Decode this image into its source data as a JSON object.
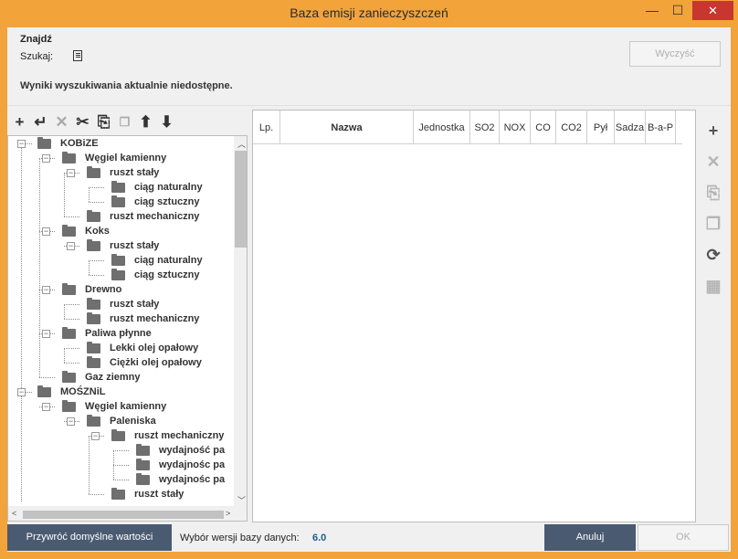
{
  "window": {
    "title": "Baza emisji zanieczyszczeń",
    "min_glyph": "—",
    "max_glyph": "☐",
    "close_glyph": "✕"
  },
  "search": {
    "section_title": "Znajdź",
    "label": "Szukaj:",
    "icon": "document-icon",
    "clear_button": "Wyczyść",
    "results_message": "Wyniki wyszukiwania aktualnie niedostępne."
  },
  "toolbar": {
    "icons": [
      {
        "name": "add-icon",
        "glyph": "+"
      },
      {
        "name": "insert-child-icon",
        "glyph": "↵"
      },
      {
        "name": "delete-icon",
        "glyph": "✕"
      },
      {
        "name": "cut-icon",
        "glyph": "✂"
      },
      {
        "name": "copy-icon",
        "glyph": "⎘"
      },
      {
        "name": "paste-icon",
        "glyph": "📋"
      },
      {
        "name": "save-up-icon",
        "glyph": "⬆"
      },
      {
        "name": "save-down-icon",
        "glyph": "⬇"
      }
    ]
  },
  "tree": {
    "nodes": [
      {
        "label": "KOBiZE",
        "level": 0
      },
      {
        "label": "Węgiel kamienny",
        "level": 1
      },
      {
        "label": "ruszt stały",
        "level": 2
      },
      {
        "label": "ciąg naturalny",
        "level": 3
      },
      {
        "label": "ciąg sztuczny",
        "level": 3
      },
      {
        "label": "ruszt mechaniczny",
        "level": 2
      },
      {
        "label": "Koks",
        "level": 1
      },
      {
        "label": "ruszt stały",
        "level": 2
      },
      {
        "label": "ciąg naturalny",
        "level": 3
      },
      {
        "label": "ciąg sztuczny",
        "level": 3
      },
      {
        "label": "Drewno",
        "level": 1
      },
      {
        "label": "ruszt stały",
        "level": 2
      },
      {
        "label": "ruszt mechaniczny",
        "level": 2
      },
      {
        "label": "Paliwa płynne",
        "level": 1
      },
      {
        "label": "Lekki olej opałowy",
        "level": 2
      },
      {
        "label": "Ciężki olej opałowy",
        "level": 2
      },
      {
        "label": "Gaz ziemny",
        "level": 1
      },
      {
        "label": "MOŚZNiL",
        "level": 0
      },
      {
        "label": "Węgiel kamienny",
        "level": 1
      },
      {
        "label": "Paleniska",
        "level": 2
      },
      {
        "label": "ruszt mechaniczny",
        "level": 3
      },
      {
        "label": "wydajność pa",
        "level": 4
      },
      {
        "label": "wydajnośc pa",
        "level": 4
      },
      {
        "label": "wydajnośc pa",
        "level": 4
      },
      {
        "label": "ruszt stały",
        "level": 3
      }
    ]
  },
  "grid": {
    "columns": [
      "Lp.",
      "Nazwa",
      "Jednostka",
      "SO2",
      "NOX",
      "CO",
      "CO2",
      "Pył",
      "Sadza",
      "B-a-P"
    ]
  },
  "right_toolbar": {
    "icons": [
      {
        "name": "add-icon",
        "glyph": "+",
        "enabled": true
      },
      {
        "name": "delete-icon",
        "glyph": "✕",
        "enabled": false
      },
      {
        "name": "copy-icon",
        "glyph": "⎘",
        "enabled": false
      },
      {
        "name": "paste-icon",
        "glyph": "❐",
        "enabled": false
      },
      {
        "name": "refresh-icon",
        "glyph": "⟳",
        "enabled": true
      },
      {
        "name": "calculator-icon",
        "glyph": "▦",
        "enabled": false
      }
    ]
  },
  "footer": {
    "restore_button": "Przywróć domyślne wartości",
    "version_label": "Wybór wersji bazy danych:",
    "version_value": "6.0",
    "cancel_button": "Anuluj",
    "ok_button": "OK"
  }
}
